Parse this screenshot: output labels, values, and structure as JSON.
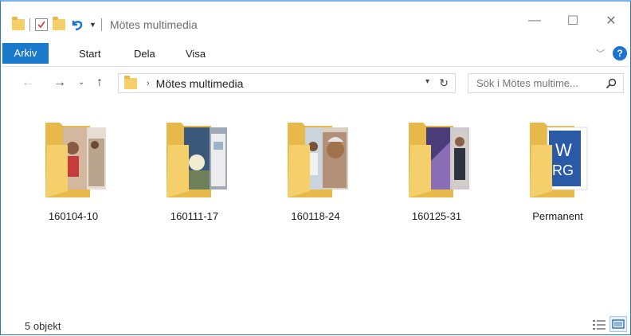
{
  "window": {
    "title": "Mötes multimedia",
    "controls": {
      "minimize": "—",
      "maximize": "☐",
      "close": "✕"
    }
  },
  "ribbon": {
    "tabs": [
      "Arkiv",
      "Start",
      "Dela",
      "Visa"
    ],
    "help": "?"
  },
  "address": {
    "path": "Mötes multimedia",
    "separator": "›"
  },
  "search": {
    "placeholder": "Sök i Mötes multime..."
  },
  "items": [
    {
      "name": "160104-10",
      "icon": "folder-photo-icon"
    },
    {
      "name": "160111-17",
      "icon": "folder-photo-icon"
    },
    {
      "name": "160118-24",
      "icon": "folder-photo-icon"
    },
    {
      "name": "160125-31",
      "icon": "folder-photo-icon"
    },
    {
      "name": "Permanent",
      "icon": "folder-jworg-icon",
      "logo_text": "JW ORG"
    }
  ],
  "status": {
    "count": "5 objekt"
  },
  "colors": {
    "accent": "#1979ca",
    "folder": "#f4cf6a",
    "folder_dark": "#e7b94b",
    "help": "#1a73d2"
  }
}
